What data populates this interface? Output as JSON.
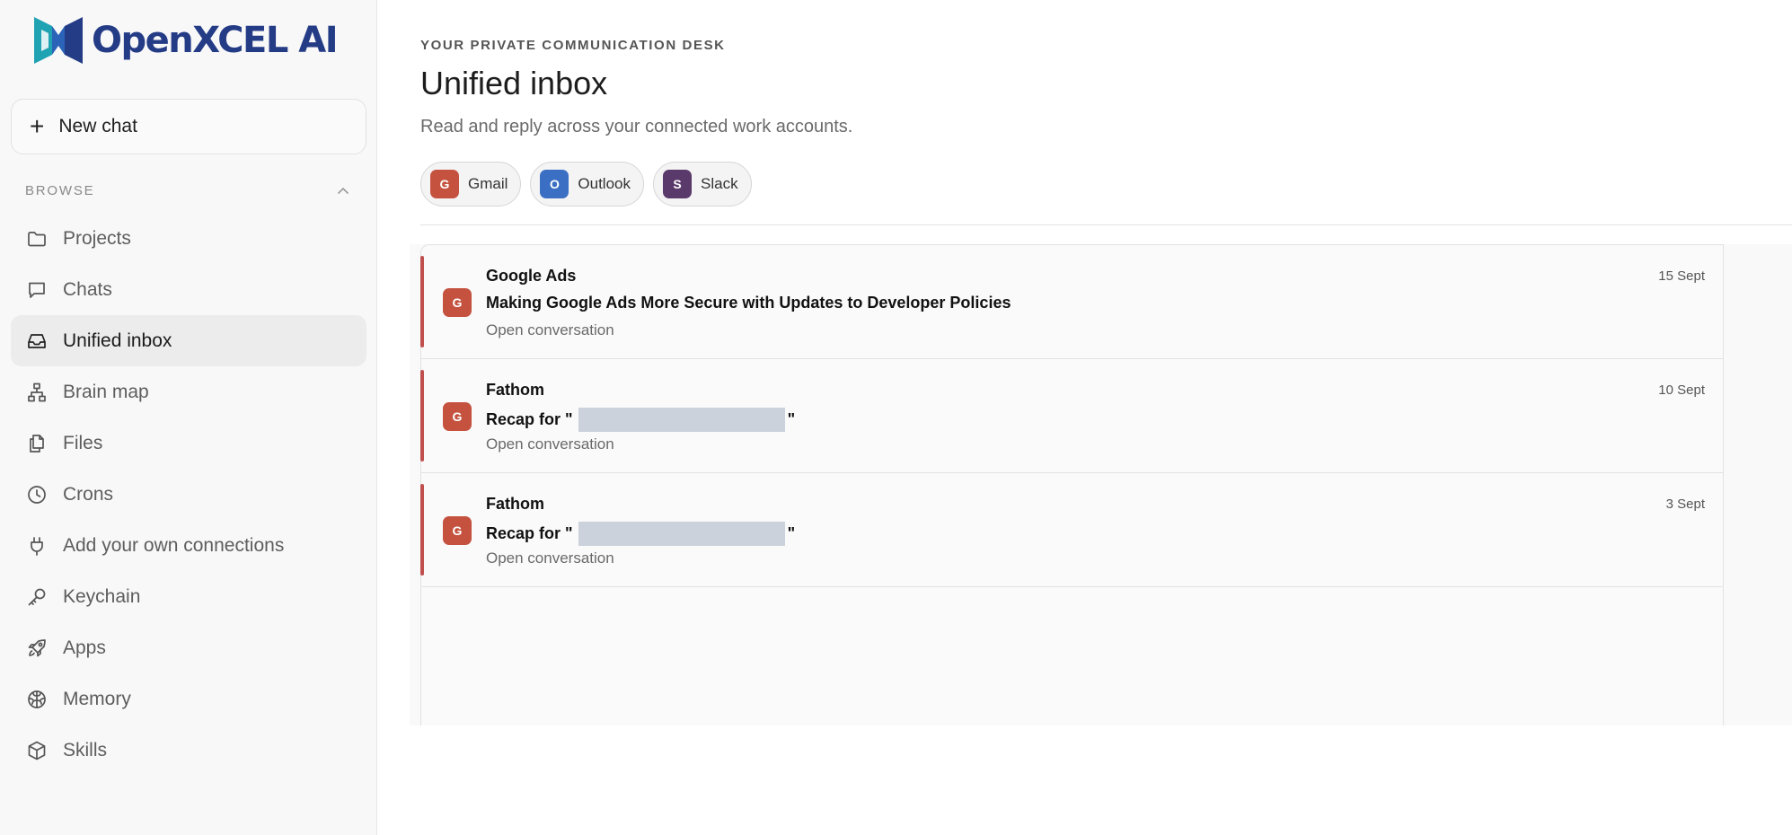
{
  "sidebar": {
    "logo_text": "OpenXCEL AI",
    "new_chat_label": "New chat",
    "browse_label": "BROWSE",
    "items": [
      {
        "label": "Projects",
        "icon": "folder-icon"
      },
      {
        "label": "Chats",
        "icon": "chat-icon"
      },
      {
        "label": "Unified inbox",
        "icon": "inbox-icon",
        "active": true
      },
      {
        "label": "Brain map",
        "icon": "hierarchy-icon"
      },
      {
        "label": "Files",
        "icon": "files-icon"
      },
      {
        "label": "Crons",
        "icon": "clock-icon"
      },
      {
        "label": "Add your own connections",
        "icon": "plug-icon"
      },
      {
        "label": "Keychain",
        "icon": "key-icon"
      },
      {
        "label": "Apps",
        "icon": "rocket-icon"
      },
      {
        "label": "Memory",
        "icon": "brain-icon"
      },
      {
        "label": "Skills",
        "icon": "cube-icon"
      }
    ]
  },
  "header": {
    "eyebrow": "YOUR PRIVATE COMMUNICATION DESK",
    "title": "Unified inbox",
    "subtitle": "Read and reply across your connected work accounts."
  },
  "accounts": [
    {
      "letter": "G",
      "label": "Gmail",
      "color": "#c5523f"
    },
    {
      "letter": "O",
      "label": "Outlook",
      "color": "#3b6fc4"
    },
    {
      "letter": "S",
      "label": "Slack",
      "color": "#5a3a6b"
    }
  ],
  "messages": [
    {
      "avatar": "G",
      "sender": "Google Ads",
      "subject_prefix": "Making Google Ads More Secure with Updates to Developer Policies",
      "redacted": false,
      "preview": "Open conversation",
      "date": "15 Sept"
    },
    {
      "avatar": "G",
      "sender": "Fathom",
      "subject_prefix": "Recap for \"",
      "subject_suffix": "\"",
      "redacted": true,
      "preview": "Open conversation",
      "date": "10 Sept"
    },
    {
      "avatar": "G",
      "sender": "Fathom",
      "subject_prefix": "Recap for \"",
      "subject_suffix": "\"",
      "redacted": true,
      "preview": "Open conversation",
      "date": "3 Sept"
    }
  ],
  "colors": {
    "brand": "#243c86",
    "brand_teal": "#1fa3b3",
    "accent_red": "#c0504d"
  }
}
